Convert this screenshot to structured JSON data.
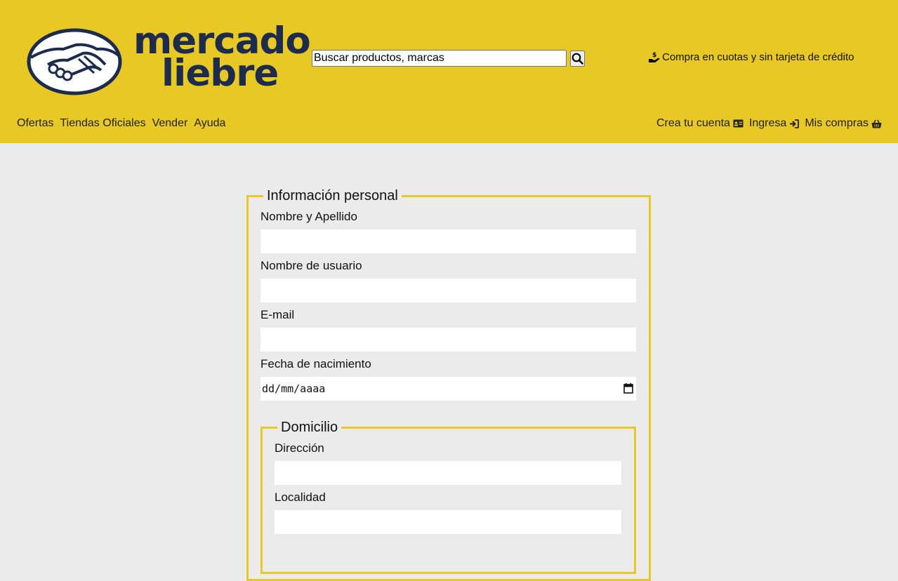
{
  "header": {
    "logo": {
      "line1": "mercado",
      "line2": "liebre",
      "icon": "handshake-icon"
    },
    "search": {
      "placeholder": "Buscar productos, marcas",
      "icon": "search-icon"
    },
    "promo": {
      "text": "Compra en cuotas y sin tarjeta de crédito",
      "icon": "hand-money-icon"
    },
    "nav_left": [
      "Ofertas",
      "Tiendas Oficiales",
      "Vender",
      "Ayuda"
    ],
    "nav_right": [
      {
        "label": "Crea tu cuenta",
        "icon": "id-card-icon"
      },
      {
        "label": "Ingresa",
        "icon": "sign-in-icon"
      },
      {
        "label": "Mis compras",
        "icon": "basket-icon"
      }
    ],
    "colors": {
      "brand_yellow": "#e8c825",
      "brand_navy": "#1c2b4e"
    }
  },
  "form": {
    "personal": {
      "legend": "Información personal",
      "fields": [
        {
          "label": "Nombre y Apellido",
          "value": ""
        },
        {
          "label": "Nombre de usuario",
          "value": ""
        },
        {
          "label": "E-mail",
          "value": ""
        },
        {
          "label": "Fecha de nacimiento",
          "value": "dd/mm/aaaa"
        }
      ]
    },
    "home": {
      "legend": "Domicilio",
      "fields": [
        {
          "label": "Dirección",
          "value": ""
        },
        {
          "label": "Localidad",
          "value": ""
        }
      ]
    }
  }
}
